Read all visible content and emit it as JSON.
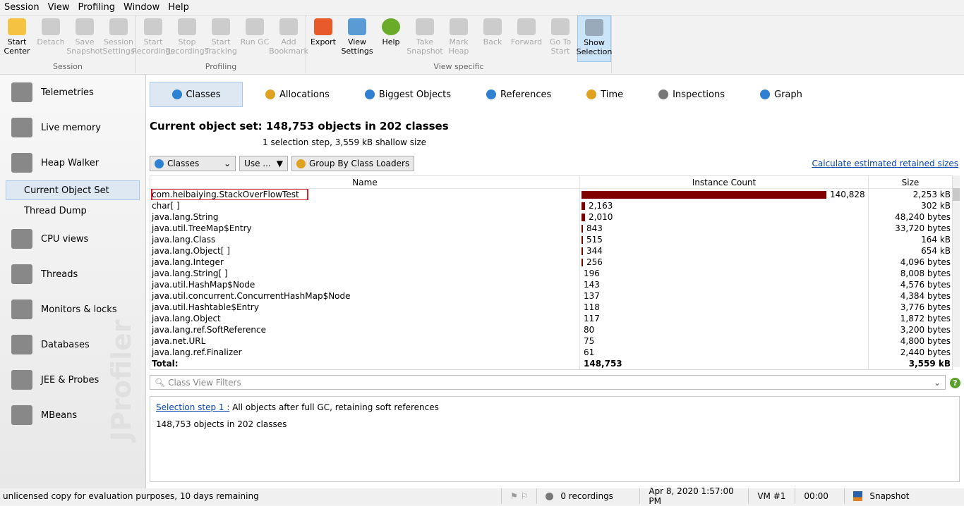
{
  "menu": [
    "Session",
    "View",
    "Profiling",
    "Window",
    "Help"
  ],
  "toolbar": {
    "groups": [
      {
        "label": "Session",
        "buttons": [
          {
            "label": "Start Center",
            "icon": "folder-play-icon",
            "enabled": true
          },
          {
            "label": "Detach",
            "icon": "detach-icon",
            "enabled": false
          },
          {
            "label": "Save Snapshot",
            "icon": "save-icon",
            "enabled": false
          },
          {
            "label": "Session Settings",
            "icon": "clipboard-icon",
            "enabled": false
          }
        ]
      },
      {
        "label": "Profiling",
        "buttons": [
          {
            "label": "Start Recordings",
            "icon": "record-icon",
            "enabled": false
          },
          {
            "label": "Stop Recordings",
            "icon": "stop-record-icon",
            "enabled": false
          },
          {
            "label": "Start Tracking",
            "icon": "tracking-icon",
            "enabled": false
          },
          {
            "label": "Run GC",
            "icon": "gc-icon",
            "enabled": false
          },
          {
            "label": "Add Bookmark",
            "icon": "bookmark-icon",
            "enabled": false
          }
        ]
      },
      {
        "label": "View specific",
        "buttons": [
          {
            "label": "Export",
            "icon": "export-icon",
            "enabled": true
          },
          {
            "label": "View Settings",
            "icon": "view-settings-icon",
            "enabled": true
          },
          {
            "label": "Help",
            "icon": "help-icon",
            "enabled": true
          },
          {
            "label": "Take Snapshot",
            "icon": "camera-icon",
            "enabled": false
          },
          {
            "label": "Mark Heap",
            "icon": "pin-icon",
            "enabled": false
          },
          {
            "label": "Back",
            "icon": "back-icon",
            "enabled": false
          },
          {
            "label": "Forward",
            "icon": "forward-icon",
            "enabled": false
          },
          {
            "label": "Go To Start",
            "icon": "home-icon",
            "enabled": false
          },
          {
            "label": "Show Selection",
            "icon": "clock-icon",
            "enabled": true,
            "selected": true
          }
        ]
      }
    ]
  },
  "sidebar": {
    "items": [
      {
        "label": "Telemetries"
      },
      {
        "label": "Live memory"
      },
      {
        "label": "Heap Walker",
        "subitems": [
          {
            "label": "Current Object Set",
            "selected": true
          },
          {
            "label": "Thread Dump"
          }
        ]
      },
      {
        "label": "CPU views"
      },
      {
        "label": "Threads"
      },
      {
        "label": "Monitors & locks"
      },
      {
        "label": "Databases"
      },
      {
        "label": "JEE & Probes"
      },
      {
        "label": "MBeans"
      }
    ],
    "watermark": "JProfiler"
  },
  "tabs": [
    "Classes",
    "Allocations",
    "Biggest Objects",
    "References",
    "Time",
    "Inspections",
    "Graph"
  ],
  "title": "Current object set:  148,753 objects in 202 classes",
  "subtitle": "1 selection step, 3,559 kB shallow size",
  "controls": {
    "view": "Classes",
    "use": "Use ...",
    "group": "Group By Class Loaders",
    "calc": "Calculate estimated retained sizes"
  },
  "table": {
    "headers": [
      "Name",
      "Instance Count",
      "Size"
    ],
    "rows": [
      [
        "com.heibaiying.StackOverFlowTest",
        140828,
        "140,828",
        "2,253 kB"
      ],
      [
        "char[ ]",
        2163,
        "2,163",
        "302 kB"
      ],
      [
        "java.lang.String",
        2010,
        "2,010",
        "48,240 bytes"
      ],
      [
        "java.util.TreeMap$Entry",
        843,
        "843",
        "33,720 bytes"
      ],
      [
        "java.lang.Class",
        515,
        "515",
        "164 kB"
      ],
      [
        "java.lang.Object[ ]",
        344,
        "344",
        "654 kB"
      ],
      [
        "java.lang.Integer",
        256,
        "256",
        "4,096 bytes"
      ],
      [
        "java.lang.String[ ]",
        196,
        "196",
        "8,008 bytes"
      ],
      [
        "java.util.HashMap$Node",
        143,
        "143",
        "4,576 bytes"
      ],
      [
        "java.util.concurrent.ConcurrentHashMap$Node",
        137,
        "137",
        "4,384 bytes"
      ],
      [
        "java.util.Hashtable$Entry",
        118,
        "118",
        "3,776 bytes"
      ],
      [
        "java.lang.Object",
        117,
        "117",
        "1,872 bytes"
      ],
      [
        "java.lang.ref.SoftReference",
        80,
        "80",
        "3,200 bytes"
      ],
      [
        "java.net.URL",
        75,
        "75",
        "4,800 bytes"
      ],
      [
        "java.lang.ref.Finalizer",
        61,
        "61",
        "2,440 bytes"
      ]
    ],
    "total": {
      "label": "Total:",
      "count": "148,753",
      "size": "3,559 kB"
    },
    "bar_color": "#800000"
  },
  "filter_placeholder": "Class View Filters",
  "info": {
    "link": "Selection step 1 :",
    "text": " All objects after full GC, retaining soft references",
    "summary": "148,753 objects in 202 classes"
  },
  "status": {
    "license": "unlicensed copy for evaluation purposes, 10 days remaining",
    "recordings": "0 recordings",
    "time": "Apr 8, 2020 1:57:00 PM",
    "vm": "VM #1",
    "elapsed": "00:00",
    "mode": "Snapshot"
  }
}
